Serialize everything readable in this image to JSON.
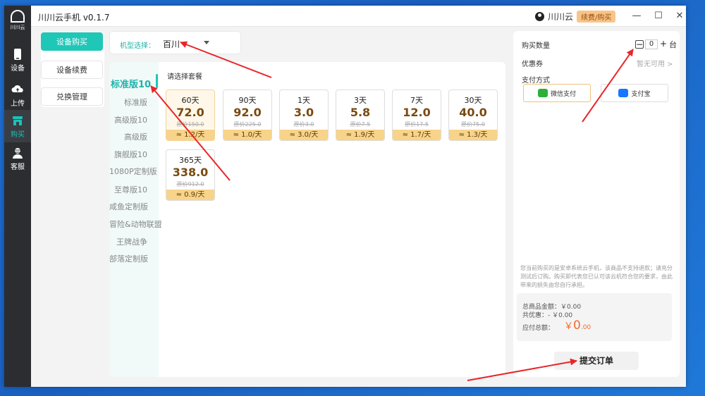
{
  "nav": {
    "logo_text": "川川云",
    "items": [
      {
        "label": "设备"
      },
      {
        "label": "上传"
      },
      {
        "label": "购买"
      },
      {
        "label": "客服"
      }
    ]
  },
  "titlebar": {
    "title": "川川云手机 v0.1.7",
    "user_name": "川川云",
    "renew_label": "续费/购买"
  },
  "menu": {
    "buy": "设备购买",
    "renew": "设备续费",
    "redeem": "兑换管理"
  },
  "model": {
    "label": "机型选择：",
    "value": "百川"
  },
  "categories": [
    "标准版10",
    "标准版",
    "高级版10",
    "高级版",
    "旗舰版10",
    "1080P定制版",
    "至尊版10",
    "咸鱼定制版",
    "冒险&动物联盟",
    "王牌战争",
    "部落定制版"
  ],
  "packages": {
    "header": "请选择套餐",
    "items": [
      {
        "days": "60天",
        "price": "72.0",
        "orig": "原价150.0",
        "daily": "≈ 1.2/天"
      },
      {
        "days": "90天",
        "price": "92.0",
        "orig": "原价225.0",
        "daily": "≈ 1.0/天"
      },
      {
        "days": "1天",
        "price": "3.0",
        "orig": "原价3.0",
        "daily": "≈ 3.0/天"
      },
      {
        "days": "3天",
        "price": "5.8",
        "orig": "原价7.5",
        "daily": "≈ 1.9/天"
      },
      {
        "days": "7天",
        "price": "12.0",
        "orig": "原价17.5",
        "daily": "≈ 1.7/天"
      },
      {
        "days": "30天",
        "price": "40.0",
        "orig": "原价75.0",
        "daily": "≈ 1.3/天"
      },
      {
        "days": "365天",
        "price": "338.0",
        "orig": "原价912.0",
        "daily": "≈ 0.9/天"
      }
    ]
  },
  "order": {
    "qty_label": "购买数量",
    "qty_value": "0",
    "qty_unit": "台",
    "coupon_label": "优惠券",
    "coupon_value": "暂无可用 >",
    "payment_label": "支付方式",
    "wechat": "微信支付",
    "alipay": "支付宝",
    "notice": "您当前购买的是安卓系统云手机，该商品不支持退款；请充分测试后订购。购买即代表您已认可该云机符合您的要求，由此带来的损失由您自行承担。",
    "total_label": "总商品金额：",
    "total_value": "￥0.00",
    "discount_label": "共优惠：",
    "discount_value": "- ￥0.00",
    "due_label": "应付总额：",
    "due_currency": "￥",
    "due_int": "0",
    "due_dec": ".00",
    "submit": "提交订单"
  },
  "colors": {
    "accent": "#1fc7b7",
    "annotation_arrow": "#e8262a",
    "price_due": "#f26b2c"
  }
}
